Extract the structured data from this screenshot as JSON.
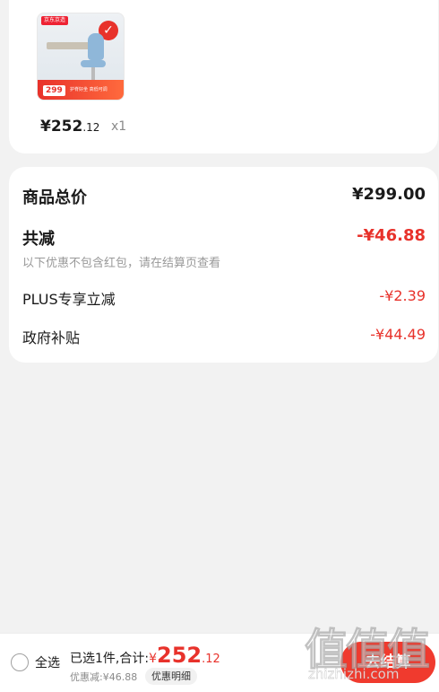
{
  "product": {
    "thumbnail": {
      "brand_tag": "京东京造",
      "promo_price": "299",
      "promo_text": "护脊好坐 高低可调"
    },
    "price_int": "¥252",
    "price_dec": ".12",
    "quantity": "x1"
  },
  "summary": {
    "total_label": "商品总价",
    "total_value": "¥299.00",
    "reduce_label": "共减",
    "reduce_value": "-¥46.88",
    "note": "以下优惠不包含红包，请在结算页查看",
    "plus_label": "PLUS专享立减",
    "plus_value": "-¥2.39",
    "gov_label": "政府补贴",
    "gov_value": "-¥44.49"
  },
  "bottom_bar": {
    "select_all": "全选",
    "selected_text": "已选1件,合计:",
    "currency": "¥",
    "amount_int": "252",
    "amount_dec": ".12",
    "discount_text": "优惠减:¥46.88",
    "detail_button": "优惠明细",
    "checkout_button": "去结算"
  },
  "watermark": {
    "big": "值值值",
    "small": "zhizhizhi.com"
  },
  "colors": {
    "accent": "#e8322b",
    "background": "#f2f2f2"
  }
}
